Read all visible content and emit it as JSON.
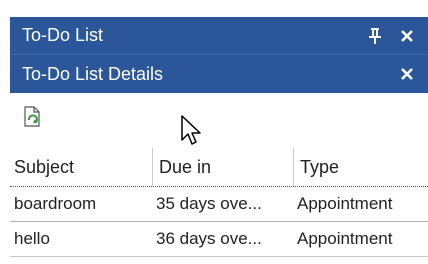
{
  "pane": {
    "todo_title": "To-Do List",
    "details_title": "To-Do List Details"
  },
  "icons": {
    "pin": "pin-icon",
    "close": "close-icon",
    "refresh": "refresh-icon",
    "cursor": "mouse-cursor-icon"
  },
  "colors": {
    "titlebar": "#2b579a",
    "refresh_green": "#3a9a3a"
  },
  "table": {
    "columns": [
      "Subject",
      "Due in",
      "Type"
    ],
    "rows": [
      {
        "subject": "boardroom",
        "due_in": "35 days ove...",
        "type": "Appointment"
      },
      {
        "subject": "hello",
        "due_in": "36 days ove...",
        "type": "Appointment"
      }
    ]
  }
}
